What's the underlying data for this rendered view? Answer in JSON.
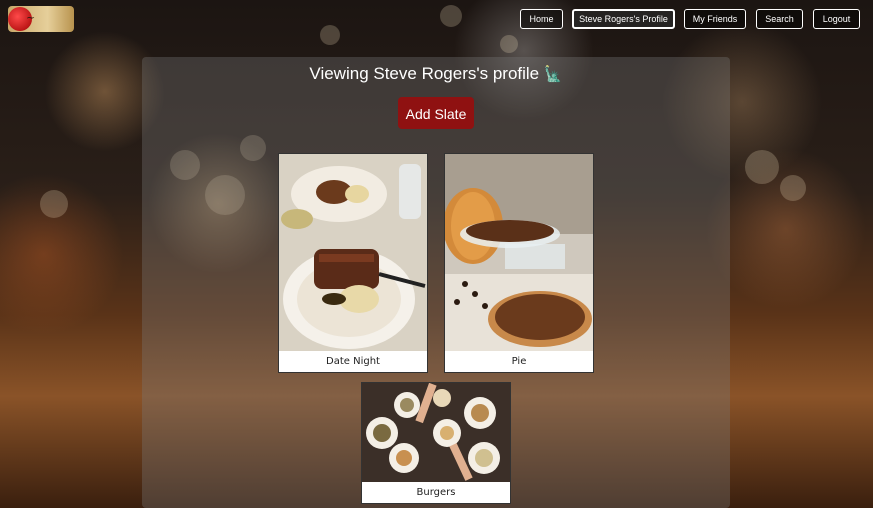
{
  "nav": {
    "logo_icon": "restaurant-logo",
    "buttons": [
      "Home",
      "Steve Rogers's Profile",
      "My Friends",
      "Search",
      "Logout"
    ]
  },
  "main": {
    "title": "Viewing Steve Rogers's profile",
    "title_emoji": "🗽",
    "add_slate_label": "Add Slate"
  },
  "slates": [
    {
      "caption": "Date Night",
      "image": "steak-dinner-photo"
    },
    {
      "caption": "Pie",
      "image": "pecan-pie-photo"
    },
    {
      "caption": "Burgers",
      "image": "shared-dishes-table-photo"
    }
  ],
  "colors": {
    "accent": "#8f1111",
    "nav_border": "#ffffff"
  }
}
